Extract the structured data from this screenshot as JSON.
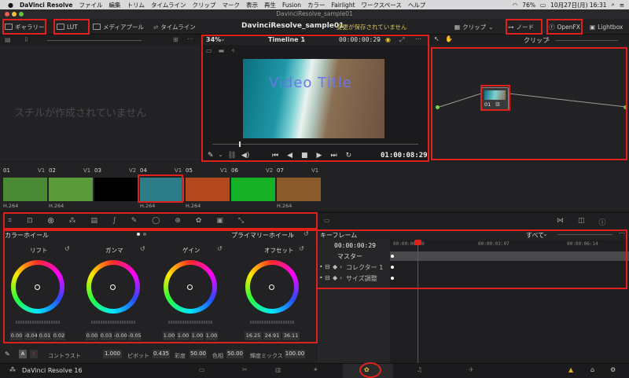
{
  "menubar": {
    "apple": "",
    "app": "DaVinci Resolve",
    "items": [
      "ファイル",
      "編集",
      "トリム",
      "タイムライン",
      "クリップ",
      "マーク",
      "表示",
      "再生",
      "Fusion",
      "カラー",
      "Fairlight",
      "ワークスペース",
      "ヘルプ"
    ],
    "battery": "76%",
    "datetime": "10月27日(月)  16:31"
  },
  "window": {
    "title": "DavinciResolve_sample01"
  },
  "toolbar": {
    "gallery": "ギャラリー",
    "lut": "LUT",
    "media_pool": "メディアプール",
    "timeline": "タイムライン",
    "project": "DavinciResolve_sample01",
    "unsaved": "変更が保存されていません",
    "clip": "クリップ",
    "node": "ノード",
    "openfx": "OpenFX",
    "lightbox": "Lightbox"
  },
  "gallery_panel": {
    "empty_text": "スチルが作成されていません"
  },
  "viewer": {
    "zoom": "34%",
    "timeline_name": "Timeline 1",
    "timecode_top": "00:00:00:29",
    "video_title": "Video Title",
    "timecode_bottom": "01:00:08:29"
  },
  "node_panel": {
    "mode": "クリップ",
    "node_label": "01"
  },
  "clips": [
    {
      "num": "01",
      "track": "V1",
      "codec": "H.264",
      "color": "#4a8a34"
    },
    {
      "num": "02",
      "track": "V1",
      "codec": "H.264",
      "color": "#5a9a3a"
    },
    {
      "num": "03",
      "track": "V2",
      "codec": "",
      "color": "#000000"
    },
    {
      "num": "04",
      "track": "V1",
      "codec": "H.264",
      "color": "#2c7d88"
    },
    {
      "num": "05",
      "track": "V1",
      "codec": "H.264",
      "color": "#b2481c"
    },
    {
      "num": "06",
      "track": "V2",
      "codec": "",
      "color": "#15b025"
    },
    {
      "num": "07",
      "track": "V1",
      "codec": "H.264",
      "color": "#8a5a2c"
    }
  ],
  "color_panel": {
    "section": "カラーホイール",
    "mode": "プライマリーホイール",
    "wheels": [
      {
        "name": "リフト",
        "values": [
          "0.00",
          "-0.04",
          "0.01",
          "0.02"
        ]
      },
      {
        "name": "ガンマ",
        "values": [
          "0.00",
          "0.03",
          "-0.00",
          "-0.05"
        ]
      },
      {
        "name": "ゲイン",
        "values": [
          "1.00",
          "1.00",
          "1.00",
          "1.00"
        ]
      },
      {
        "name": "オフセット",
        "values": [
          "16.25",
          "24.91",
          "36.11"
        ]
      }
    ],
    "controls": {
      "mode_a": "A",
      "page_1": "1",
      "contrast_label": "コントラスト",
      "contrast": "1.000",
      "pivot_label": "ピボット",
      "pivot": "0.435",
      "sat_label": "彩度",
      "sat": "50.00",
      "hue_label": "色相",
      "hue": "50.00",
      "lum_mix_label": "輝度ミックス",
      "lum_mix": "100.00"
    }
  },
  "keyframe_panel": {
    "title": "キーフレーム",
    "filter": "すべて",
    "timecode": "00:00:00:29",
    "ruler": [
      "00:00:00:00",
      "00:00:03:07",
      "00:00:06:14"
    ],
    "tracks": [
      "マスター",
      "コレクター 1",
      "サイズ調整"
    ]
  },
  "bottom": {
    "app_label": "DaVinci Resolve 16"
  }
}
